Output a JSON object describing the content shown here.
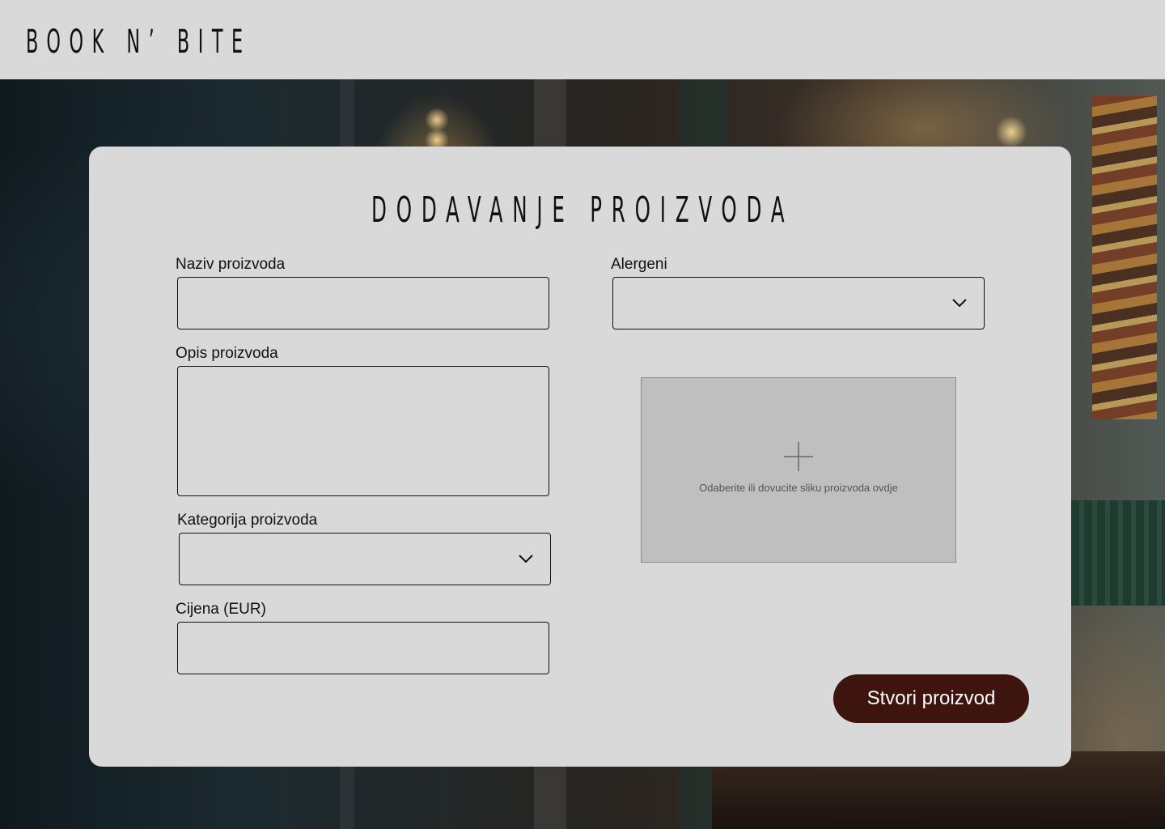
{
  "header": {
    "brand": "BOOK N’ BITE"
  },
  "form": {
    "title": "DODAVANJE PROIZVODA",
    "name": {
      "label": "Naziv proizvoda",
      "value": ""
    },
    "description": {
      "label": "Opis proizvoda",
      "value": ""
    },
    "category": {
      "label": "Kategorija proizvoda",
      "selected": "",
      "icon": "chevron-down-icon"
    },
    "price": {
      "label": "Cijena (EUR)",
      "value": ""
    },
    "allergens": {
      "label": "Alergeni",
      "selected": "",
      "icon": "chevron-down-icon"
    },
    "image_upload": {
      "icon": "plus-icon",
      "hint": "Odaberite ili dovucite sliku proizvoda ovdje"
    },
    "submit_label": "Stvori proizvod"
  },
  "colors": {
    "page_background": "#d9d9d9",
    "card_background": "#d9d9d9",
    "upload_background": "#bfbfbf",
    "submit_background": "#3d140e",
    "submit_text": "#ffffff",
    "text": "#111111"
  }
}
